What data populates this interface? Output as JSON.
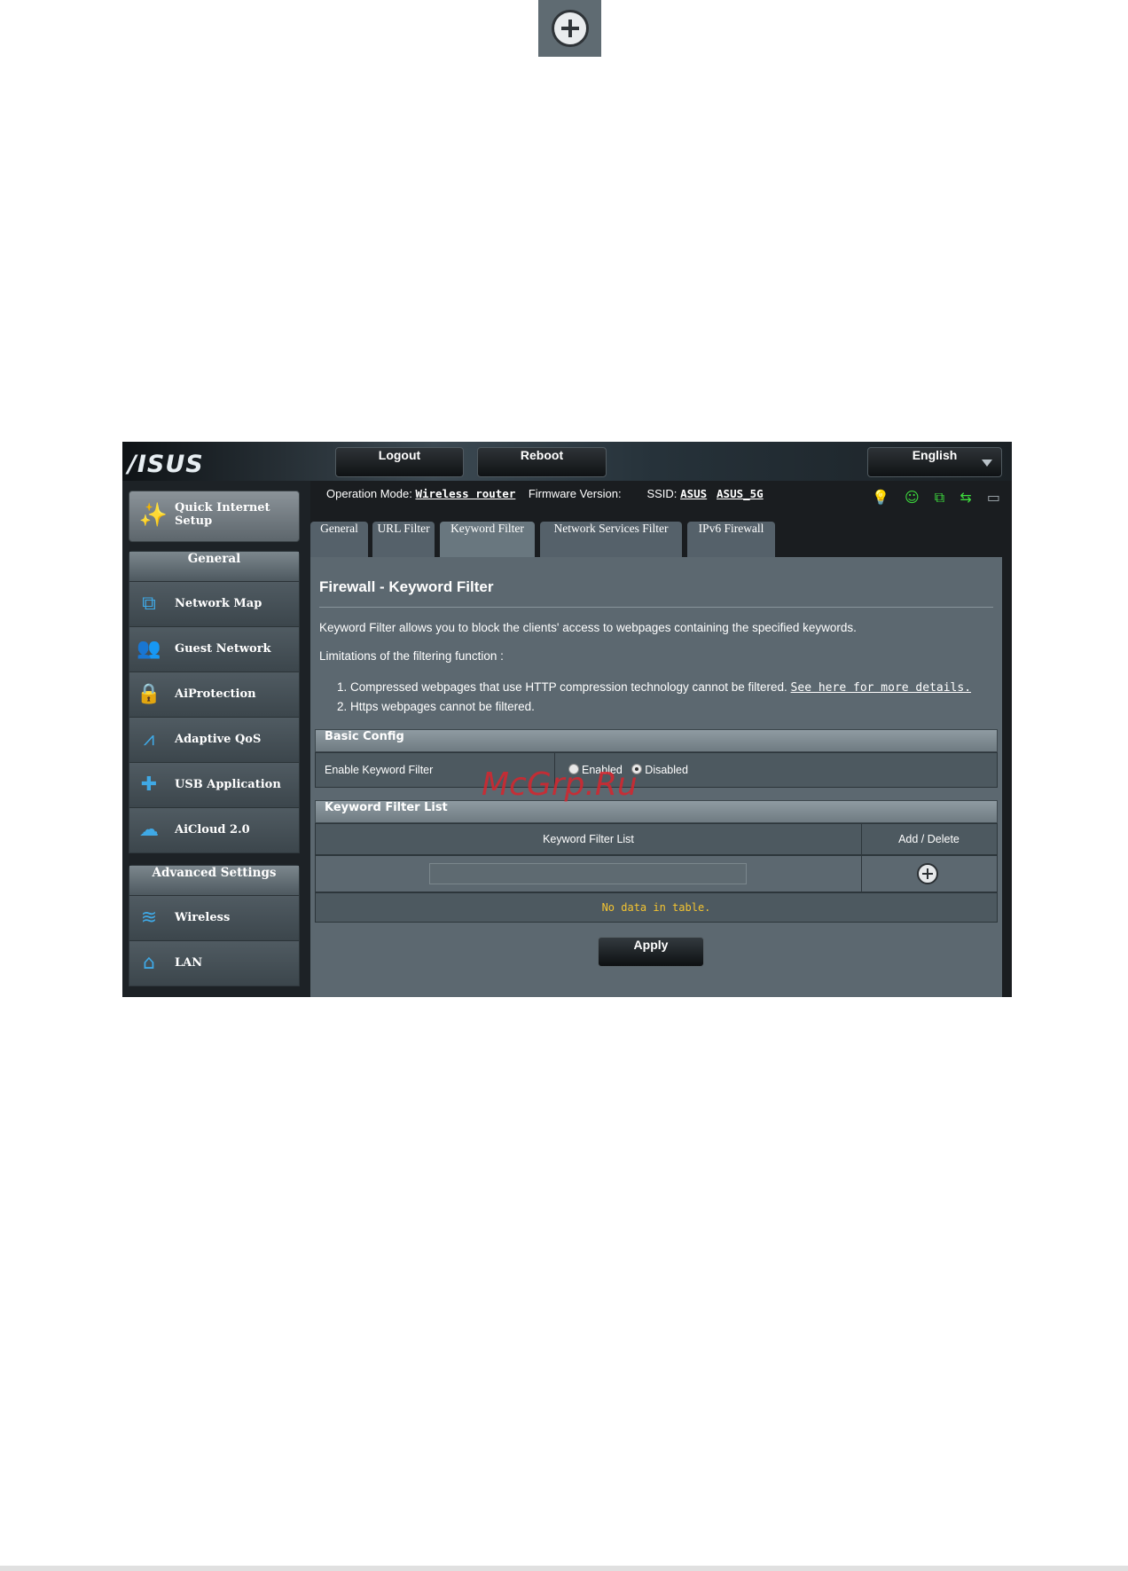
{
  "logo_text": "/ISUS",
  "header": {
    "logout_label": "Logout",
    "reboot_label": "Reboot",
    "language_label": "English"
  },
  "status": {
    "op_mode_label": "Operation Mode:",
    "op_mode_value": "Wireless router",
    "firmware_label": "Firmware Version:",
    "ssid_label": "SSID:",
    "ssid_1": "ASUS",
    "ssid_2": "ASUS_5G"
  },
  "sidebar": {
    "quick_setup_label": "Quick Internet\nSetup",
    "general_head": "General",
    "general_items": [
      {
        "label": "Network Map",
        "icon": "network-map-icon"
      },
      {
        "label": "Guest Network",
        "icon": "guest-network-icon"
      },
      {
        "label": "AiProtection",
        "icon": "lock-icon"
      },
      {
        "label": "Adaptive QoS",
        "icon": "qos-icon"
      },
      {
        "label": "USB Application",
        "icon": "puzzle-icon"
      },
      {
        "label": "AiCloud 2.0",
        "icon": "cloud-icon"
      }
    ],
    "advanced_head": "Advanced Settings",
    "advanced_items": [
      {
        "label": "Wireless",
        "icon": "wifi-icon"
      },
      {
        "label": "LAN",
        "icon": "home-icon"
      }
    ]
  },
  "tabs": [
    "General",
    "URL Filter",
    "Keyword Filter",
    "Network Services Filter",
    "IPv6 Firewall"
  ],
  "panel": {
    "title": "Firewall - Keyword Filter",
    "description": "Keyword Filter allows you to block the clients' access to webpages containing the specified keywords.",
    "limitations_label": "Limitations of the filtering function :",
    "limit_1": "1.  Compressed webpages that use HTTP compression technology cannot be filtered.",
    "limit_1_link": "See here for more details.",
    "limit_2": "2.  Https webpages cannot be filtered.",
    "basic_config_head": "Basic Config",
    "enable_label": "Enable Keyword Filter",
    "radio_enabled": "Enabled",
    "radio_disabled": "Disabled",
    "list_head": "Keyword Filter List",
    "col_keyword": "Keyword Filter List",
    "col_add_delete": "Add / Delete",
    "no_data": "No data in table.",
    "apply_label": "Apply"
  },
  "watermark": "McGrp.Ru",
  "colors": {
    "panel_bg": "#5c6870",
    "accent_blue": "#3fa9e6",
    "no_data_yellow": "#f4c430",
    "watermark_red": "#d7262e"
  }
}
